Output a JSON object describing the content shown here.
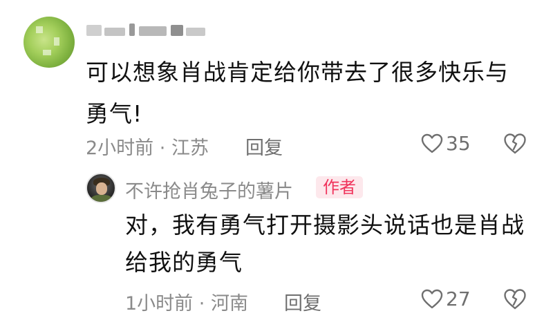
{
  "comment": {
    "username_hidden": true,
    "text": "可以想象肖战肯定给你带去了很多快乐与勇气!",
    "time": "2小时前",
    "location": "江苏",
    "reply_label": "回复",
    "likes": "35"
  },
  "reply": {
    "username": "不许抢肖兔子的薯片",
    "badge": "作者",
    "text": "对，我有勇气打开摄影头说话也是肖战给我的勇气",
    "time": "1小时前",
    "location": "河南",
    "reply_label": "回复",
    "likes": "27"
  },
  "colors": {
    "badge_text": "#f0345c",
    "badge_bg": "#fde8ec",
    "meta_text": "#8a8a8a"
  },
  "icons": [
    "heart-outline-icon",
    "broken-heart-icon"
  ]
}
